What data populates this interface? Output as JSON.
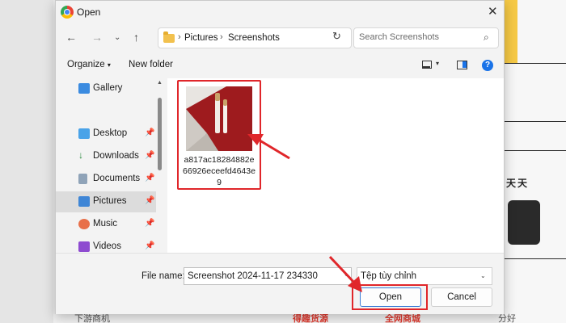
{
  "background": {
    "right_cjk_1": "天",
    "right_cjk_2": "天",
    "bottom_text_1": "下游商机",
    "bottom_red_1": "得趣货源",
    "bottom_red_2": "全网商城",
    "bottom_text_2": "分好"
  },
  "dialog": {
    "title": "Open",
    "close_icon": "close-icon"
  },
  "nav": {
    "breadcrumb": [
      "Pictures",
      "Screenshots"
    ],
    "search_placeholder": "Search Screenshots"
  },
  "commands": {
    "organize": "Organize",
    "new_folder": "New folder",
    "help": "?"
  },
  "sidebar": {
    "items": [
      {
        "label": "Gallery",
        "icon": "gallery-icon",
        "pinned": false,
        "selected": false
      },
      {
        "label": "Desktop",
        "icon": "desktop-icon",
        "pinned": true,
        "selected": false
      },
      {
        "label": "Downloads",
        "icon": "downloads-icon",
        "pinned": true,
        "selected": false
      },
      {
        "label": "Documents",
        "icon": "documents-icon",
        "pinned": true,
        "selected": false
      },
      {
        "label": "Pictures",
        "icon": "pictures-icon",
        "pinned": true,
        "selected": true
      },
      {
        "label": "Music",
        "icon": "music-icon",
        "pinned": true,
        "selected": false
      },
      {
        "label": "Videos",
        "icon": "videos-icon",
        "pinned": true,
        "selected": false
      }
    ]
  },
  "files": [
    {
      "name": "a817ac18284882e66926eceefd4643e9"
    }
  ],
  "bottom": {
    "file_name_label": "File name:",
    "file_name_value": "Screenshot 2024-11-17 234330",
    "file_type": "Tệp tùy chỉnh",
    "open_label": "Open",
    "cancel_label": "Cancel"
  },
  "colors": {
    "accent": "#1a73e8",
    "annotation_red": "#e0262a"
  }
}
